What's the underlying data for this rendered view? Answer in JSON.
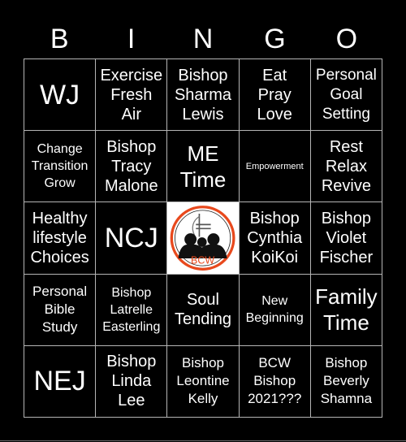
{
  "header": {
    "letters": [
      "B",
      "I",
      "N",
      "G",
      "O"
    ]
  },
  "card": {
    "rows": [
      [
        {
          "text": "WJ",
          "size": "xl"
        },
        {
          "text": "Exercise\nFresh\nAir",
          "size": "m"
        },
        {
          "text": "Bishop\nSharma\nLewis",
          "size": "m"
        },
        {
          "text": "Eat\nPray\nLove",
          "size": "m"
        },
        {
          "text": "Personal\nGoal\nSetting",
          "size": "ms"
        }
      ],
      [
        {
          "text": "Change\nTransition\nGrow",
          "size": "xs"
        },
        {
          "text": "Bishop\nTracy\nMalone",
          "size": "m"
        },
        {
          "text": "ME\nTime",
          "size": "l"
        },
        {
          "text": "Empowerment",
          "size": "xxs"
        },
        {
          "text": "Rest\nRelax\nRevive",
          "size": "m"
        }
      ],
      [
        {
          "text": "Healthy\nlifestyle\nChoices",
          "size": "m"
        },
        {
          "text": "NCJ",
          "size": "xl"
        },
        {
          "text": "",
          "free": true,
          "logo_text": "BCW"
        },
        {
          "text": "Bishop\nCynthia\nKoiKoi",
          "size": "m"
        },
        {
          "text": "Bishop\nViolet\nFischer",
          "size": "m"
        }
      ],
      [
        {
          "text": "Personal\nBible\nStudy",
          "size": "s"
        },
        {
          "text": "Bishop\nLatrelle\nEasterling",
          "size": "xs"
        },
        {
          "text": "Soul\nTending",
          "size": "m"
        },
        {
          "text": "New\nBeginning",
          "size": "xs"
        },
        {
          "text": "Family\nTime",
          "size": "l"
        }
      ],
      [
        {
          "text": "NEJ",
          "size": "xl"
        },
        {
          "text": "Bishop\nLinda\nLee",
          "size": "m"
        },
        {
          "text": "Bishop\nLeontine\nKelly",
          "size": "s"
        },
        {
          "text": "BCW\nBishop\n2021???",
          "size": "s"
        },
        {
          "text": "Bishop\nBeverly\nShamna",
          "size": "s"
        }
      ]
    ]
  },
  "logo": {
    "text": "BCW",
    "ring_color": "#e8491d",
    "figure_color": "#111111"
  },
  "colors": {
    "background": "#000000",
    "text": "#ffffff",
    "grid_line": "#b5b5b5"
  }
}
